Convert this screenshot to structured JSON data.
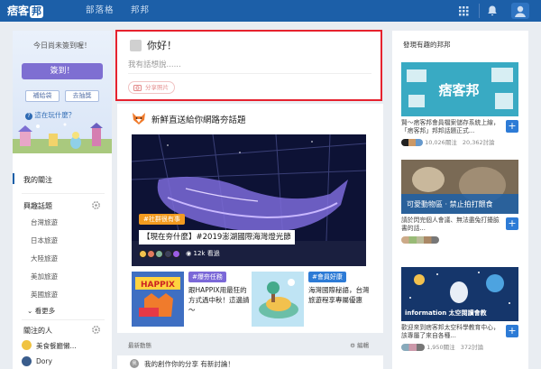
{
  "topbar": {
    "logo_main": "痞客",
    "logo_tag": "邦",
    "nav_blog": "部落格",
    "nav_bang": "邦邦",
    "accent": "#1c5fa8"
  },
  "left": {
    "checkin_text": "今日尚未簽到喔！",
    "checkin_button": "簽到！",
    "supply_button": "補給袋",
    "lottery_button": "去抽獎",
    "playing_text": "這在玩什麼？",
    "my_follow": "我的關注",
    "interest_title": "興趣話題",
    "topics": [
      "台灣旅遊",
      "日本旅遊",
      "大陸旅遊",
      "美加旅遊",
      "英國旅遊"
    ],
    "see_more": "看更多",
    "people_title": "關注的人",
    "people": [
      "美食餐廳懶...",
      "Dory"
    ]
  },
  "post": {
    "greeting": "你好！",
    "placeholder": "我有話想說......",
    "share_photo": "分享照片"
  },
  "feed": {
    "title": "新鮮直送給你網路夯話題",
    "hero_tag": "#社群很有事",
    "hero_title": "【現在夯什麼】#2019澎湖國際海灣燈光節",
    "hero_views": "12k 看過",
    "cards": [
      {
        "tag": "#爆夯任務",
        "tag_color": "#7b68d8",
        "text": "跟HAPPIX用最狂的方式過中秋！這邊請～"
      },
      {
        "tag": "#會員好康",
        "tag_color": "#2d7bd6",
        "text": "海灣國際秘語，台灣旅遊程享專屬優惠"
      }
    ],
    "latest_label": "最新動態",
    "edit_label": "編輯",
    "mine_avatar": "我",
    "mine_text": "我的創作你的分享 有新討論！"
  },
  "right": {
    "title": "發現有趣的邦邦",
    "cards": [
      {
        "desc": "賢～痞客邦會員檔案儲存系統上線，「痞客邦」邦邦話題正式...",
        "followers": "10,026關注",
        "posts": "20,362討論"
      },
      {
        "desc": "請於閃完個人會議、無法盡兔打擾臉書的話...",
        "followers": "",
        "posts": ""
      },
      {
        "desc": "歡迎來到痞客邦太空科學教育中心，該專屬了來自各種...",
        "followers": "1,950關注",
        "posts": "372討論"
      }
    ],
    "card2_banner": "可愛動物區 ‧ 禁止拍打餵食",
    "card3_banner": "information 太空閱讀會教",
    "plus": "+"
  }
}
